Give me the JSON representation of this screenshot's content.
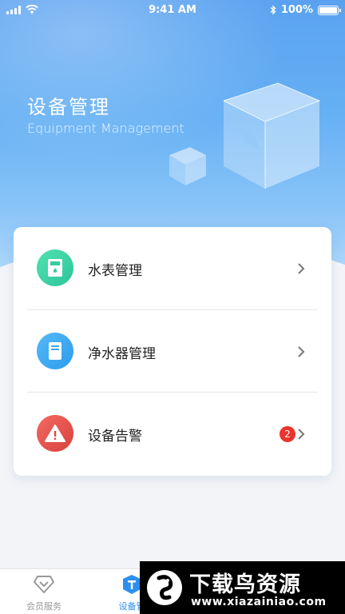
{
  "status_bar": {
    "time": "9:41 AM",
    "battery": "100%",
    "icons": [
      "signal-icon",
      "wifi-icon",
      "bluetooth-icon",
      "battery-icon"
    ]
  },
  "hero": {
    "title": "设备管理",
    "subtitle": "Equipment Management"
  },
  "menu": {
    "items": [
      {
        "label": "水表管理",
        "icon": "water-meter-icon",
        "color": "#33cc9f"
      },
      {
        "label": "净水器管理",
        "icon": "water-purifier-icon",
        "color": "#3aa7f1"
      },
      {
        "label": "设备告警",
        "icon": "warning-icon",
        "color": "#e0463f",
        "badge": "2"
      }
    ]
  },
  "tab_bar": {
    "tabs": [
      {
        "label": "会员服务",
        "icon": "diamond-icon",
        "active": false
      },
      {
        "label": "设备管",
        "icon": "device-icon",
        "active": true
      }
    ]
  },
  "watermark": {
    "title": "下载鸟资源",
    "url": "www.xiazainiao.com"
  },
  "colors": {
    "accent": "#2d8ef0",
    "badge": "#e8352d",
    "hero_top": "#5aa2f0"
  }
}
